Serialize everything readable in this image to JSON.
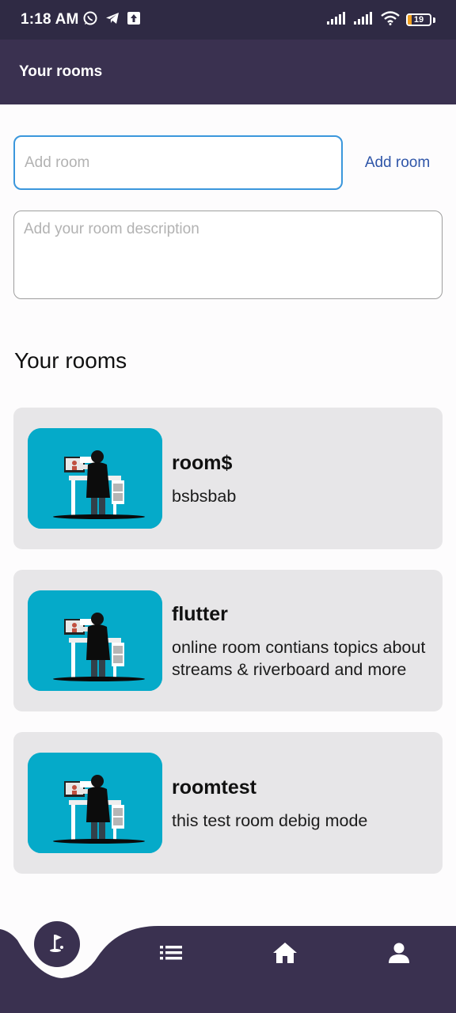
{
  "status_bar": {
    "time": "1:18 AM",
    "battery_level": "19",
    "icons": [
      "whatsapp-icon",
      "telegram-icon",
      "upload-icon",
      "signal-icon",
      "signal-icon",
      "wifi-icon",
      "battery-icon"
    ]
  },
  "app_bar": {
    "title": "Your rooms"
  },
  "form": {
    "room_placeholder": "Add room",
    "room_value": "",
    "add_button_label": "Add room",
    "description_placeholder": "Add your room description",
    "description_value": ""
  },
  "section": {
    "title": "Your rooms"
  },
  "rooms": [
    {
      "name": "room$",
      "description": "bsbsbab"
    },
    {
      "name": "flutter",
      "description": "online room contians topics about streams & riverboard and more"
    },
    {
      "name": "roomtest",
      "description": "this test room debig mode"
    }
  ],
  "bottom_nav": {
    "items": [
      "golf-icon",
      "list-icon",
      "home-icon",
      "person-icon"
    ]
  },
  "colors": {
    "primary_dark": "#3a3150",
    "status_bar": "#2f2a44",
    "accent_blue": "#3b97dc",
    "button_text": "#2f55a8",
    "card_bg": "#e7e6e8",
    "thumb_bg": "#05aac9"
  }
}
